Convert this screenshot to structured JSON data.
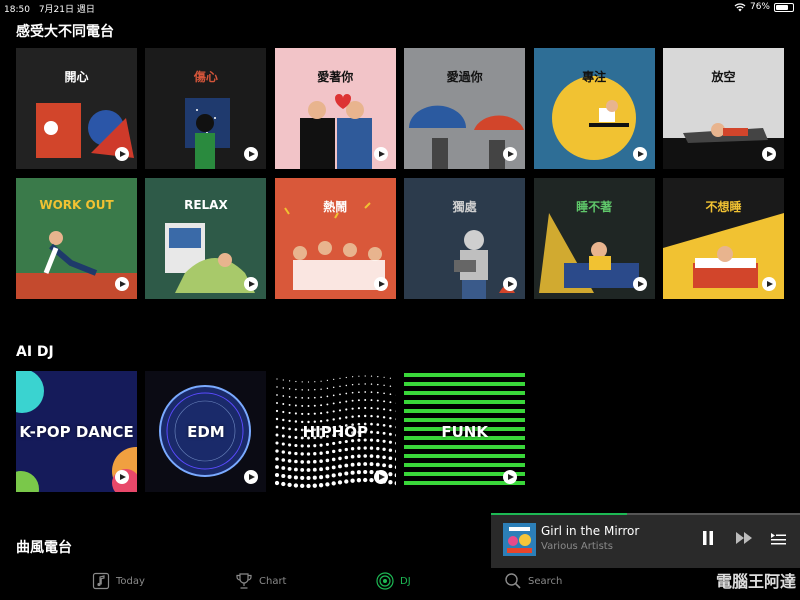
{
  "status_bar": {
    "time": "18:50",
    "date": "7月21日 週日",
    "battery": "76%",
    "battery_level": 0.76
  },
  "sections": {
    "radio_title": "感受大不同電台",
    "ai_title": "AI DJ",
    "genre_title": "曲風電台"
  },
  "radio_tiles": [
    {
      "title": "開心",
      "bg": "#222222",
      "title_color": "#ffffff"
    },
    {
      "title": "傷心",
      "bg": "#1b1b1b",
      "title_color": "#d4553a"
    },
    {
      "title": "愛著你",
      "bg": "#f2c4c8",
      "title_color": "#111111"
    },
    {
      "title": "愛過你",
      "bg": "#8f9194",
      "title_color": "#111111"
    },
    {
      "title": "專注",
      "bg": "#2e6e96",
      "title_color": "#111111"
    },
    {
      "title": "放空",
      "bg": "#d8d8d8",
      "title_color": "#111111"
    },
    {
      "title": "WORK OUT",
      "bg": "#3a7a4a",
      "title_color": "#f1c232"
    },
    {
      "title": "RELAX",
      "bg": "#2e5a48",
      "title_color": "#ffffff"
    },
    {
      "title": "熱鬧",
      "bg": "#d9583a",
      "title_color": "#ffffff"
    },
    {
      "title": "獨處",
      "bg": "#2c3b4c",
      "title_color": "#cfcfcf"
    },
    {
      "title": "睡不著",
      "bg": "#1f2624",
      "title_color": "#5fc76a"
    },
    {
      "title": "不想睡",
      "bg": "#1a1a1a",
      "title_color": "#f1c232"
    }
  ],
  "ai_tiles": [
    {
      "title": "K-POP DANCE"
    },
    {
      "title": "EDM"
    },
    {
      "title": "HIPHOP"
    },
    {
      "title": "FUNK"
    }
  ],
  "mini_player": {
    "track": "Girl in the Mirror",
    "artist": "Various Artists",
    "progress": 0.44
  },
  "tabs": [
    {
      "label": "Today",
      "icon": "music-note-icon"
    },
    {
      "label": "Chart",
      "icon": "trophy-icon"
    },
    {
      "label": "DJ",
      "icon": "dj-radio-icon"
    },
    {
      "label": "Search",
      "icon": "search-icon"
    }
  ],
  "watermark": "電腦王阿達",
  "colors": {
    "accent": "#1db954",
    "background": "#000000",
    "player_bg": "#2a2a2a"
  }
}
